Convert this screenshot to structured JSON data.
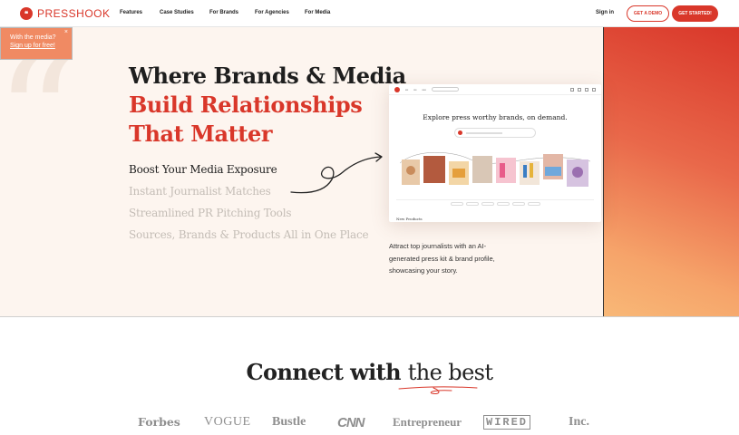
{
  "nav": {
    "brand": "PRESSHOOK",
    "links": [
      "Features",
      "Case Studies",
      "For Brands",
      "For Agencies",
      "For Media"
    ],
    "signin": "Sign in",
    "demo_label": "GET A DEMO",
    "start_label": "GET STARTED!"
  },
  "toast": {
    "line1": "With the media?",
    "line2": "Sign up for free!",
    "close": "×"
  },
  "hero": {
    "headline_line1": "Where Brands & Media",
    "headline_line2": "Build Relationships",
    "headline_line3": "That Matter",
    "benefits": [
      "Boost Your Media Exposure",
      "Instant Journalist Matches",
      "Streamlined PR Pitching Tools",
      "Sources, Brands & Products All in One Place"
    ],
    "mockup_title": "Explore press worthy brands, on demand.",
    "mockup_footer": "New Products",
    "caption": "Attract top journalists with an AI-generated press kit & brand profile, showcasing your story."
  },
  "connect": {
    "prefix": "Connect with",
    "emphasis": "the best"
  },
  "press_logos": [
    "Forbes",
    "VOGUE",
    "Bustle",
    "CNN",
    "Entrepreneur",
    "WIRED",
    "Inc."
  ],
  "colors": {
    "brand_red": "#d9372a",
    "hero_bg": "#fdf5ef",
    "toast_bg": "#f08a63"
  }
}
